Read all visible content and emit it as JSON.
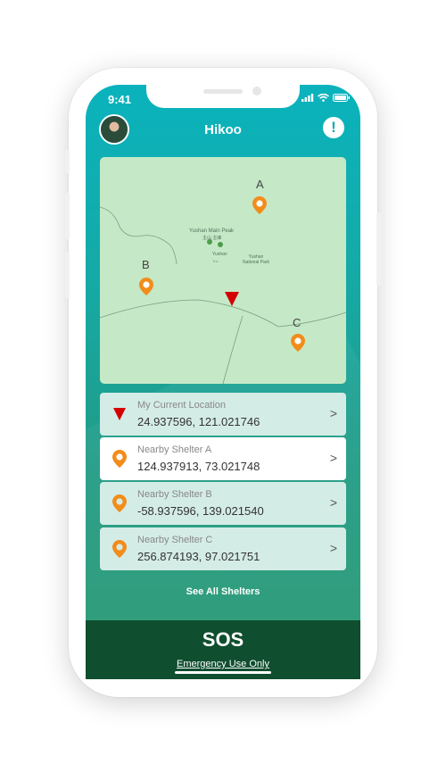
{
  "status_bar": {
    "time": "9:41"
  },
  "header": {
    "title": "Hikoo",
    "avatar": "avatar",
    "alert_icon": "!"
  },
  "map": {
    "markers": [
      {
        "label": "A",
        "icon": "pin-icon"
      },
      {
        "label": "B",
        "icon": "pin-icon"
      },
      {
        "label": "C",
        "icon": "pin-icon"
      }
    ],
    "map_text": {
      "peak": "Yushan Main Peak",
      "peak_sub": "主山 主峰",
      "park": "Yushan National Park",
      "small1": "Yushan",
      "small2": "Tra..."
    }
  },
  "locations": [
    {
      "title": "My Current Location",
      "coords": "24.937596, 121.021746",
      "icon": "triangle-marker-icon"
    },
    {
      "title": "Nearby Shelter A",
      "coords": "124.937913, 73.021748",
      "icon": "pin-icon"
    },
    {
      "title": "Nearby Shelter B",
      "coords": "-58.937596, 139.021540",
      "icon": "pin-icon"
    },
    {
      "title": "Nearby Shelter C",
      "coords": "256.874193, 97.021751",
      "icon": "pin-icon"
    }
  ],
  "chevron": ">",
  "see_all_label": "See All Shelters",
  "sos": {
    "label": "SOS",
    "sub_label": "Emergency Use Only"
  },
  "colors": {
    "accent": "#0ab3bd",
    "pin": "#f28c1a",
    "current": "#d40000",
    "sos_bg": "#0f4e2e"
  }
}
